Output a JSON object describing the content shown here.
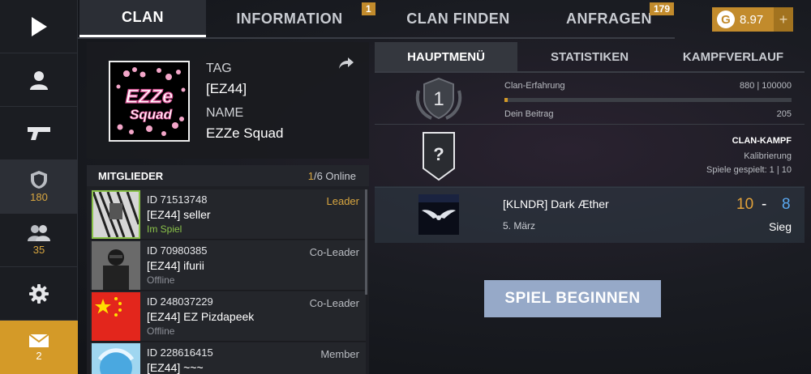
{
  "nav": {
    "clan_points": "180",
    "members_count": "35",
    "mail_count": "2"
  },
  "tabs": [
    {
      "label": "CLAN",
      "badge": ""
    },
    {
      "label": "INFORMATION",
      "badge": "1"
    },
    {
      "label": "CLAN FINDEN",
      "badge": ""
    },
    {
      "label": "ANFRAGEN",
      "badge": "179"
    }
  ],
  "currency": {
    "icon": "G",
    "amount": "8.97",
    "plus": "+"
  },
  "clan": {
    "tag_label": "TAG",
    "tag": "[EZ44]",
    "name_label": "NAME",
    "name": "EZZe Squad",
    "logo_text_1": "EZZe",
    "logo_text_2": "Squad"
  },
  "members": {
    "title": "MITGLIEDER",
    "online_count": "1",
    "online_total": "/6 Online",
    "list": [
      {
        "id": "ID 71513748",
        "name": "[EZ44] seller",
        "status": "Im Spiel",
        "role": "Leader"
      },
      {
        "id": "ID 70980385",
        "name": "[EZ44] ifurii",
        "status": "Offline",
        "role": "Co-Leader"
      },
      {
        "id": "ID 248037229",
        "name": "[EZ44] EZ Pizdapeek",
        "status": "Offline",
        "role": "Co-Leader"
      },
      {
        "id": "ID 228616415",
        "name": "[EZ44] ~~~",
        "status": "",
        "role": "Member"
      }
    ]
  },
  "subtabs": [
    "HAUPTMENÜ",
    "STATISTIKEN",
    "KAMPFVERLAUF"
  ],
  "experience": {
    "rank": "1",
    "label": "Clan-Erfahrung",
    "value": "880 | 100000",
    "progress": 0.0088,
    "contrib_label": "Dein Beitrag",
    "contrib_value": "205"
  },
  "clan_war": {
    "rank_symbol": "?",
    "title": "CLAN-KAMPF",
    "calibration": "Kalibrierung",
    "played": "Spiele gespielt: 1 | 10"
  },
  "match": {
    "opponent": "[KLNDR] Dark Æther",
    "date": "5. März",
    "score_own": "10",
    "score_sep": "-",
    "score_opp": "8",
    "result": "Sieg"
  },
  "start_button": "SPIEL BEGINNEN"
}
